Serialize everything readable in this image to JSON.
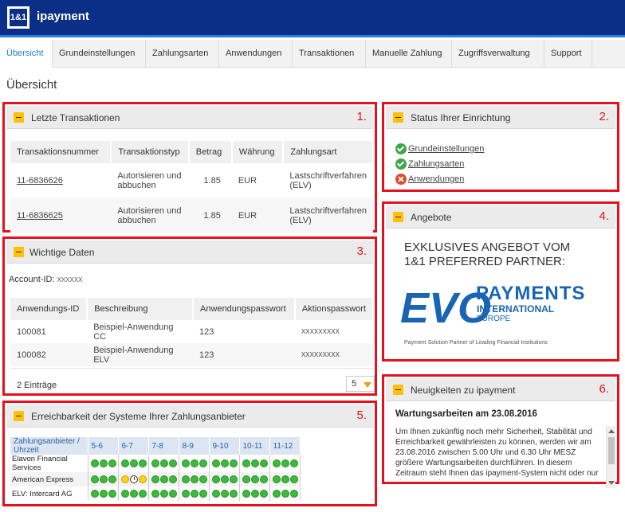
{
  "header": {
    "logo_text": "1&1",
    "app_name": "ipayment"
  },
  "nav": [
    "Übersicht",
    "Grundeinstellungen",
    "Zahlungsarten",
    "Anwendungen",
    "Transaktionen",
    "Manuelle Zahlung",
    "Zugriffsverwaltung",
    "Support"
  ],
  "page_title": "Übersicht",
  "panels": {
    "transactions": {
      "title": "Letzte Transaktionen",
      "number": "1.",
      "headers": [
        "Transaktionsnummer",
        "Transaktionstyp",
        "Betrag",
        "Währung",
        "Zahlungsart"
      ],
      "rows": [
        {
          "id": "11-6836626",
          "type_line1": "Autorisieren und",
          "type_line2": "abbuchen",
          "amount": "1.85",
          "currency": "EUR",
          "method_line1": "Lastschriftverfahren",
          "method_line2": "(ELV)"
        },
        {
          "id": "11-6836625",
          "type_line1": "Autorisieren und",
          "type_line2": "abbuchen",
          "amount": "1.85",
          "currency": "EUR",
          "method_line1": "Lastschriftverfahren",
          "method_line2": "(ELV)"
        }
      ]
    },
    "status": {
      "title": "Status Ihrer Einrichtung",
      "number": "2.",
      "items": [
        {
          "label": "Grundeinstellungen",
          "state": "ok"
        },
        {
          "label": "Zahlungsarten",
          "state": "ok"
        },
        {
          "label": "Anwendungen",
          "state": "error"
        }
      ]
    },
    "important": {
      "title": "Wichtige Daten",
      "number": "3.",
      "account_label": "Account-ID:",
      "account_value": "XXXXXX",
      "headers": [
        "Anwendungs-ID",
        "Beschreibung",
        "Anwendungspasswort",
        "Aktionspasswort"
      ],
      "rows": [
        {
          "id": "100081",
          "desc": "Beispiel-Anwendung CC",
          "app_pw": "123",
          "action_pw": "XXXXXXXXX"
        },
        {
          "id": "100082",
          "desc": "Beispiel-Anwendung ELV",
          "app_pw": "123",
          "action_pw": "XXXXXXXXX"
        }
      ],
      "entries": "2 Einträge",
      "page_size": "5"
    },
    "offers": {
      "title": "Angebote",
      "number": "4.",
      "headline_line1": "EXKLUSIVES ANGEBOT VOM",
      "headline_line2": "1&1 PREFERRED PARTNER:",
      "logo_text": "EVO",
      "payments": "PAYMENTS",
      "international": "INTERNATIONAL",
      "europe": "EUROPE",
      "tagline": "Payment Solution Partner of Leading Financial Institutions"
    },
    "availability": {
      "title": "Erreichbarkeit der Systeme Ihrer Zahlungsanbieter",
      "number": "5.",
      "header_first": "Zahlungsanbieter / Uhrzeit",
      "columns": [
        "5-6",
        "6-7",
        "7-8",
        "8-9",
        "9-10",
        "10-11",
        "11-12"
      ],
      "rows": [
        {
          "name": "Elavon Financial Services"
        },
        {
          "name": "American Express"
        },
        {
          "name": "ELV: Intercard AG"
        }
      ]
    },
    "news": {
      "title": "Neuigkeiten zu ipayment",
      "number": "6.",
      "headline": "Wartungsarbeiten am 23.08.2016",
      "body": "Um Ihnen zukünftig noch mehr Sicherheit, Stabilität und Erreichbarkeit gewährleisten zu können, werden wir am 23.08.2016 zwischen 5.00 Uhr und 6.30 Uhr MESZ größere Wartungsarbeiten durchführen. In diesem Zeitraum steht Ihnen das ipayment-System nicht oder nur eingeschränkt zur Verfügung."
    }
  },
  "colors": {
    "header": "#0b2f86",
    "accent": "#1a7fd6",
    "highlight": "#e4121e",
    "ok": "#3da84a",
    "warning": "#ffd21a"
  }
}
